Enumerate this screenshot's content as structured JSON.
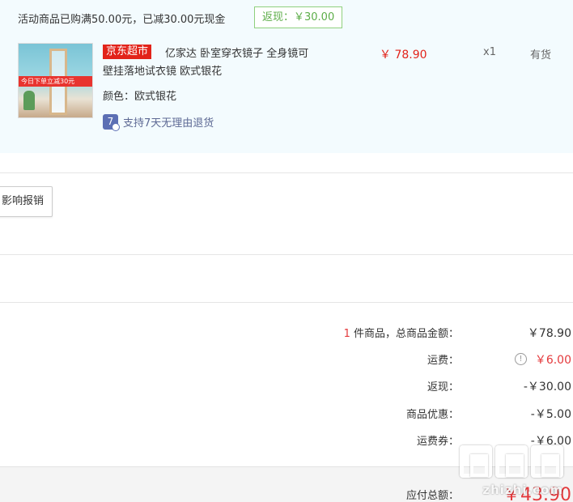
{
  "promo": {
    "text": "活动商品已购满50.00元，已减30.00元现金",
    "badge": "返现：￥30.00"
  },
  "product": {
    "thumb_banner": "今日下单立减30元",
    "store_tag": "京东超市",
    "title_line1": "亿家达 卧室穿衣镜子 全身镜可",
    "title_line2": "壁挂落地试衣镜 欧式银花",
    "attribute": "颜色：欧式银花",
    "return_icon_char": "7",
    "return_policy": "支持7天无理由退货",
    "price": "￥ 78.90",
    "quantity": "x1",
    "stock": "有货"
  },
  "report_button": "影响报销",
  "summary": {
    "count": "1",
    "goods_label": " 件商品，总商品金额：",
    "goods_value": "￥78.90",
    "shipping_label": "运费：",
    "shipping_value": "￥6.00",
    "cashback_label": "返现：",
    "cashback_value": "-￥30.00",
    "discount_label": "商品优惠：",
    "discount_value": "-￥5.00",
    "coupon_label": "运费券：",
    "coupon_value": "-￥6.00",
    "total_label": "应付总额：",
    "total_value": "￥43.90"
  },
  "watermark": {
    "text": "zhizhi.com"
  },
  "icons": {
    "info": "info-icon",
    "return": "seven-day-return-icon"
  },
  "colors": {
    "price_red": "#e2231a",
    "accent_red": "#e4393c",
    "promo_green": "#5cad48",
    "panel_blue": "#f3fbfe"
  }
}
